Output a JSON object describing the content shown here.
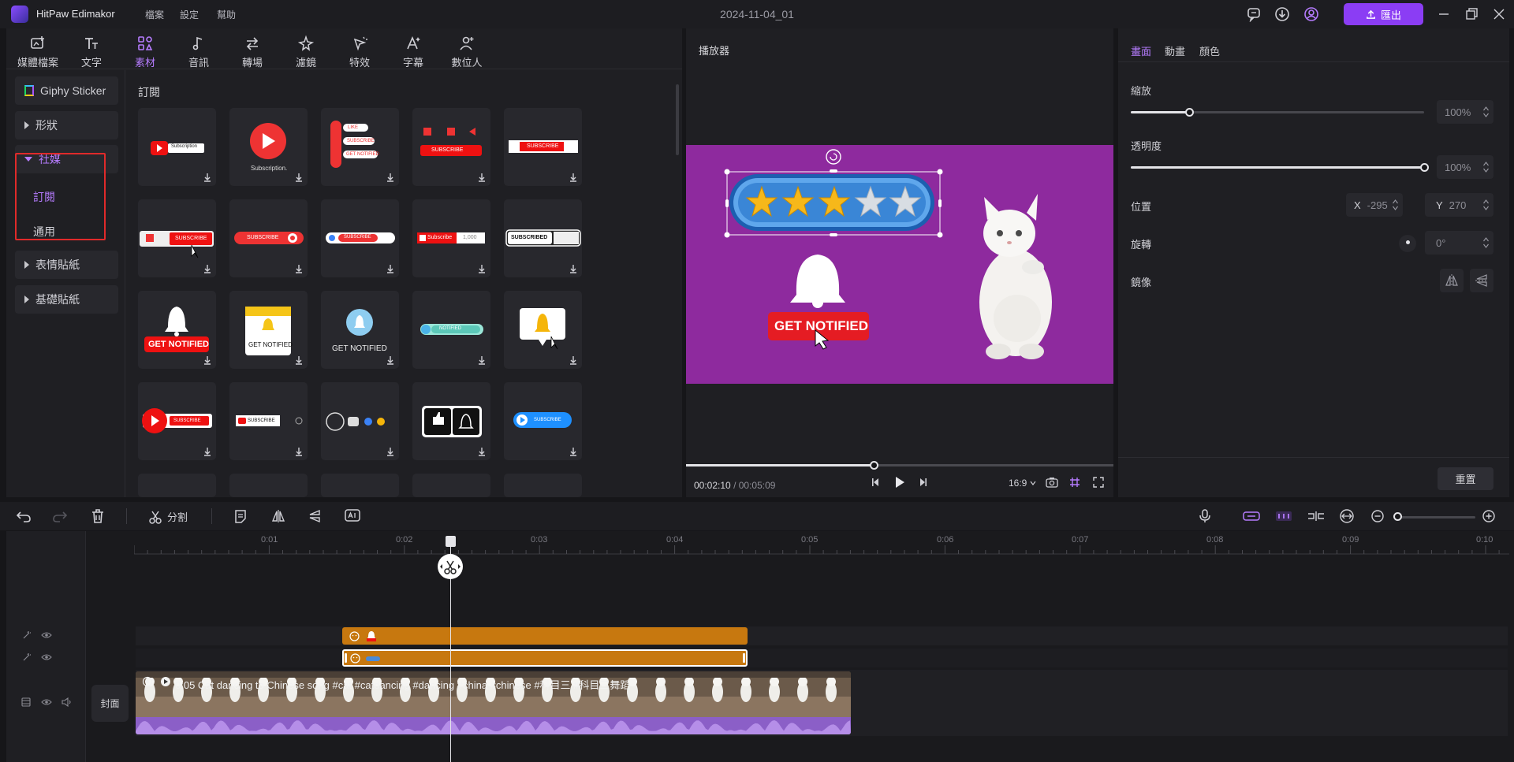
{
  "app": {
    "name": "HitPaw Edimakor",
    "project_title": "2024-11-04_01"
  },
  "menu": [
    "檔案",
    "設定",
    "幫助"
  ],
  "export_label": "匯出",
  "toolbar": [
    {
      "label": "媒體檔案",
      "icon": "media-icon"
    },
    {
      "label": "文字",
      "icon": "text-icon"
    },
    {
      "label": "素材",
      "icon": "elements-icon",
      "active": true
    },
    {
      "label": "音訊",
      "icon": "audio-icon"
    },
    {
      "label": "轉場",
      "icon": "transition-icon"
    },
    {
      "label": "濾鏡",
      "icon": "filter-icon"
    },
    {
      "label": "特效",
      "icon": "effects-icon"
    },
    {
      "label": "字幕",
      "icon": "subtitle-icon"
    },
    {
      "label": "數位人",
      "icon": "digital-human-icon"
    }
  ],
  "categories": {
    "giphy": "Giphy Sticker",
    "shapes": "形狀",
    "social": "社媒",
    "social_sub": [
      "訂閱",
      "通用"
    ],
    "emoji": "表情貼紙",
    "basic": "基礎貼紙"
  },
  "section_title": "訂閱",
  "stickers": {
    "subscription_text": "Subscription",
    "subscription_dot": "Subscription.",
    "like": "LIKE",
    "subscribe": "SUBSCRIBE",
    "get_notified": "GET NOTIFIED",
    "subscribed": "SUBSCRIBED",
    "subscribe_small": "Subscribe",
    "count": "1,000",
    "notified_lower": "NOTIFIED"
  },
  "player": {
    "title": "播放器",
    "current_time": "00:02:10",
    "total_time": "/ 00:05:09",
    "aspect": "16:9",
    "overlay_text": "GET NOTIFIED",
    "progress": 0.42
  },
  "properties": {
    "tabs": [
      "畫面",
      "動畫",
      "顏色"
    ],
    "scale_label": "縮放",
    "scale_value": "100%",
    "scale_level": 0.2,
    "opacity_label": "透明度",
    "opacity_value": "100%",
    "opacity_level": 1.0,
    "position_label": "位置",
    "x_key": "X",
    "x_value": "-295",
    "y_key": "Y",
    "y_value": "270",
    "rotate_label": "旋轉",
    "rotate_value": "0°",
    "mirror_label": "鏡像",
    "reset_label": "重置"
  },
  "timeline": {
    "split_label": "分割",
    "ticks": [
      "0:01",
      "0:02",
      "0:03",
      "0:04",
      "0:05",
      "0:06",
      "0:07",
      "0:08",
      "0:09",
      "0:10"
    ],
    "cover_label": "封面",
    "clip_title": "0:05 Cat dancing to Chinese song #cat #catdancing #dancing #china #chinese #科目三 #科目三舞蹈"
  },
  "colors": {
    "accent": "#8b3df4",
    "accent_text": "#b67cff",
    "clip_orange": "#c7780f",
    "canvas_bg": "#8e2a9e"
  }
}
